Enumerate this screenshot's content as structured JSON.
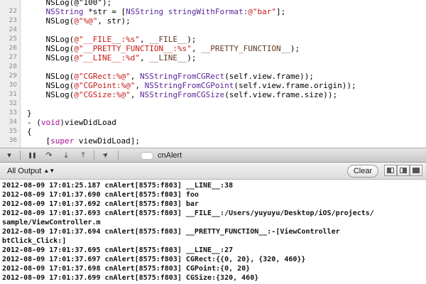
{
  "editor": {
    "lines": [
      {
        "num": "",
        "segments": [
          {
            "t": "    NSLog(@\"100\");",
            "c": "plain"
          }
        ]
      },
      {
        "num": "22",
        "segments": [
          {
            "t": "    ",
            "c": "plain"
          },
          {
            "t": "NSString",
            "c": "cls"
          },
          {
            "t": " *str = [",
            "c": "plain"
          },
          {
            "t": "NSString",
            "c": "cls"
          },
          {
            "t": " ",
            "c": "plain"
          },
          {
            "t": "stringWithFormat:",
            "c": "cls"
          },
          {
            "t": "@\"bar\"",
            "c": "str"
          },
          {
            "t": "];",
            "c": "plain"
          }
        ]
      },
      {
        "num": "23",
        "segments": [
          {
            "t": "    NSLog(",
            "c": "plain"
          },
          {
            "t": "@\"%@\"",
            "c": "str"
          },
          {
            "t": ", str);",
            "c": "plain"
          }
        ]
      },
      {
        "num": "24",
        "segments": []
      },
      {
        "num": "25",
        "segments": [
          {
            "t": "    NSLog(",
            "c": "plain"
          },
          {
            "t": "@\"__FILE__:%s\"",
            "c": "str"
          },
          {
            "t": ", ",
            "c": "plain"
          },
          {
            "t": "__FILE__",
            "c": "mac"
          },
          {
            "t": ");",
            "c": "plain"
          }
        ]
      },
      {
        "num": "26",
        "segments": [
          {
            "t": "    NSLog(",
            "c": "plain"
          },
          {
            "t": "@\"__PRETTY_FUNCTION__:%s\"",
            "c": "str"
          },
          {
            "t": ", ",
            "c": "plain"
          },
          {
            "t": "__PRETTY_FUNCTION__",
            "c": "mac"
          },
          {
            "t": ");",
            "c": "plain"
          }
        ]
      },
      {
        "num": "27",
        "segments": [
          {
            "t": "    NSLog(",
            "c": "plain"
          },
          {
            "t": "@\"__LINE__:%d\"",
            "c": "str"
          },
          {
            "t": ", ",
            "c": "plain"
          },
          {
            "t": "__LINE__",
            "c": "mac"
          },
          {
            "t": ");",
            "c": "plain"
          }
        ]
      },
      {
        "num": "28",
        "segments": []
      },
      {
        "num": "29",
        "segments": [
          {
            "t": "    NSLog(",
            "c": "plain"
          },
          {
            "t": "@\"CGRect:%@\"",
            "c": "str"
          },
          {
            "t": ", ",
            "c": "plain"
          },
          {
            "t": "NSStringFromCGRect",
            "c": "cls"
          },
          {
            "t": "(self.view.frame));",
            "c": "plain"
          }
        ]
      },
      {
        "num": "30",
        "segments": [
          {
            "t": "    NSLog(",
            "c": "plain"
          },
          {
            "t": "@\"CGPoint:%@\"",
            "c": "str"
          },
          {
            "t": ", ",
            "c": "plain"
          },
          {
            "t": "NSStringFromCGPoint",
            "c": "cls"
          },
          {
            "t": "(self.view.frame.origin));",
            "c": "plain"
          }
        ]
      },
      {
        "num": "31",
        "segments": [
          {
            "t": "    NSLog(",
            "c": "plain"
          },
          {
            "t": "@\"CGSize:%@\"",
            "c": "str"
          },
          {
            "t": ", ",
            "c": "plain"
          },
          {
            "t": "NSStringFromCGSize",
            "c": "cls"
          },
          {
            "t": "(self.view.frame.size));",
            "c": "plain"
          }
        ]
      },
      {
        "num": "32",
        "segments": []
      },
      {
        "num": "33",
        "segments": [
          {
            "t": "}",
            "c": "plain"
          }
        ]
      },
      {
        "num": "34",
        "segments": [
          {
            "t": "- (",
            "c": "plain"
          },
          {
            "t": "void",
            "c": "kw"
          },
          {
            "t": ")viewDidLoad",
            "c": "plain"
          }
        ]
      },
      {
        "num": "35",
        "segments": [
          {
            "t": "{",
            "c": "plain"
          }
        ]
      },
      {
        "num": "36",
        "segments": [
          {
            "t": "    [",
            "c": "plain"
          },
          {
            "t": "super",
            "c": "kw"
          },
          {
            "t": " viewDidLoad];",
            "c": "plain"
          }
        ]
      }
    ]
  },
  "debugbar": {
    "buttons": [
      {
        "name": "hide-debug-area-icon",
        "glyph": "▾"
      },
      {
        "name": "pause-icon",
        "glyph": "❚❚"
      },
      {
        "name": "step-over-icon",
        "glyph": "↷"
      },
      {
        "name": "step-into-icon",
        "glyph": "⤓"
      },
      {
        "name": "step-out-icon",
        "glyph": "⤒"
      },
      {
        "name": "location-arrow-icon",
        "glyph": "➤"
      }
    ],
    "thread_label": "cnAlert"
  },
  "console": {
    "scope_label": "All Output",
    "scope_arrows": "▲▼",
    "clear_label": "Clear",
    "lines": [
      "2012-08-09 17:01:25.187 cnAlert[8575:f803] __LINE__:38",
      "2012-08-09 17:01:37.690 cnAlert[8575:f803] foo",
      "2012-08-09 17:01:37.692 cnAlert[8575:f803] bar",
      "2012-08-09 17:01:37.693 cnAlert[8575:f803] __FILE__:/Users/yuyuyu/Desktop/iOS/projects/",
      "sample/ViewController.m",
      "2012-08-09 17:01:37.694 cnAlert[8575:f803] __PRETTY_FUNCTION__:-[ViewController",
      "btClick_Click:]",
      "2012-08-09 17:01:37.695 cnAlert[8575:f803] __LINE__:27",
      "2012-08-09 17:01:37.697 cnAlert[8575:f803] CGRect:{{0, 20}, {320, 460}}",
      "2012-08-09 17:01:37.698 cnAlert[8575:f803] CGPoint:{0, 20}",
      "2012-08-09 17:01:37.699 cnAlert[8575:f803] CGSize:{320, 460}"
    ]
  },
  "colors": {
    "string": "#c41a16",
    "class": "#5c2699",
    "macro": "#643820",
    "keyword": "#aa0d91"
  }
}
